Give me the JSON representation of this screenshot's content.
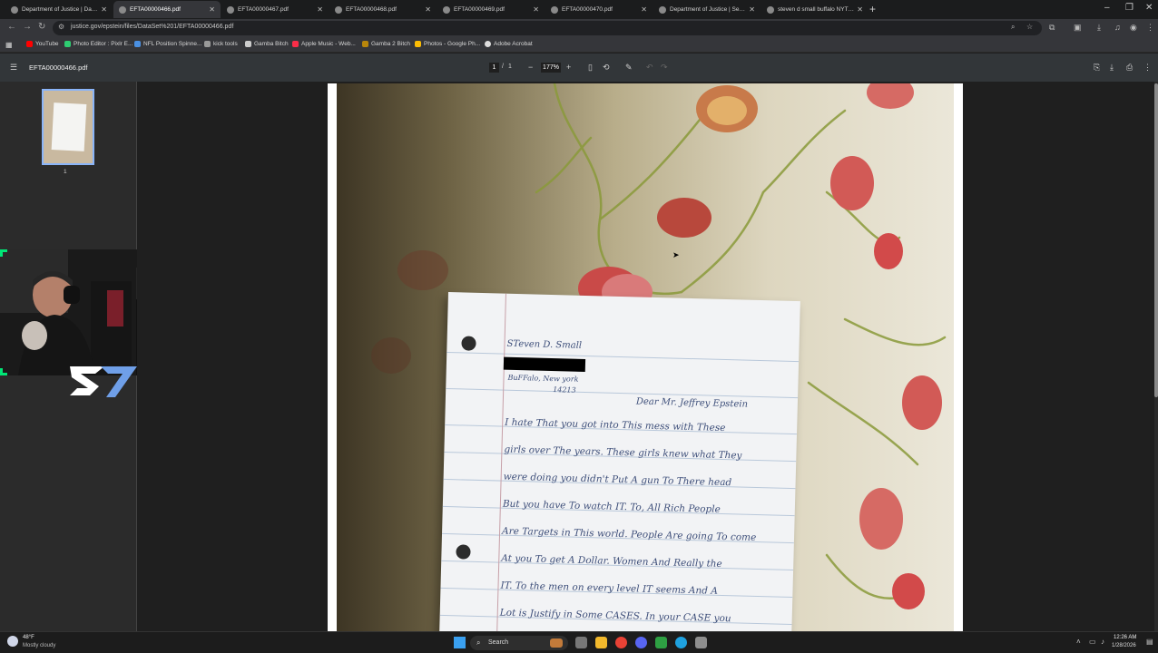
{
  "tabs": [
    {
      "label": "Department of Justice | Data Se",
      "active": false
    },
    {
      "label": "EFTA00000466.pdf",
      "active": true
    },
    {
      "label": "EFTA00000467.pdf",
      "active": false
    },
    {
      "label": "EFTA00000468.pdf",
      "active": false
    },
    {
      "label": "EFTA00000469.pdf",
      "active": false
    },
    {
      "label": "EFTA00000470.pdf",
      "active": false
    },
    {
      "label": "Department of Justice | Search",
      "active": false
    },
    {
      "label": "steven d small buffalo NYT - G",
      "active": false
    }
  ],
  "address_bar": {
    "url": "justice.gov/epstein/files/DataSet%201/EFTA00000466.pdf"
  },
  "bookmarks": [
    {
      "label": "YouTube",
      "color": "#ff0000"
    },
    {
      "label": "Photo Editor : Pixlr E...",
      "color": "#2ecc71"
    },
    {
      "label": "NFL Position Spinne...",
      "color": "#4a90e2"
    },
    {
      "label": "kick tools",
      "color": "#999999"
    },
    {
      "label": "Gamba Bitch",
      "color": "#cccccc"
    },
    {
      "label": "Apple Music - Web...",
      "color": "#fa2d48"
    },
    {
      "label": "Gamba 2 Bitch",
      "color": "#b8860b"
    },
    {
      "label": "Photos - Google Ph...",
      "color": "#fbbc04"
    },
    {
      "label": "Adobe Acrobat",
      "color": "#dddddd"
    }
  ],
  "pdf_viewer": {
    "filename": "EFTA00000466.pdf",
    "current_page": "1",
    "page_sep": "/",
    "total_pages": "1",
    "zoom": "177%",
    "thumbnail_number": "1"
  },
  "overlay": {
    "counter": "5"
  },
  "letter": {
    "header_name": "STeven D. Small",
    "header_city": "BuFFalo, New york",
    "header_zip": "14213",
    "salutation": "Dear Mr. Jeffrey Epstein",
    "lines": [
      "I hate That you got into This mess with These",
      "girls over The years. These girls knew what They",
      "were doing you didn't Put A gun To There head",
      "But you have To watch IT. To, All Rich People",
      "Are Targets in This world. People Are going To come",
      "At you To get A Dollar. Women And Really the",
      "IT. To the men on every level IT seems And A",
      "Lot is Justify in Some CASES. In your CASE you"
    ]
  },
  "taskbar": {
    "weather_temp": "48°F",
    "weather_condition": "Mostly cloudy",
    "search_label": "Search",
    "time": "12:26 AM",
    "date": "1/28/2026"
  }
}
